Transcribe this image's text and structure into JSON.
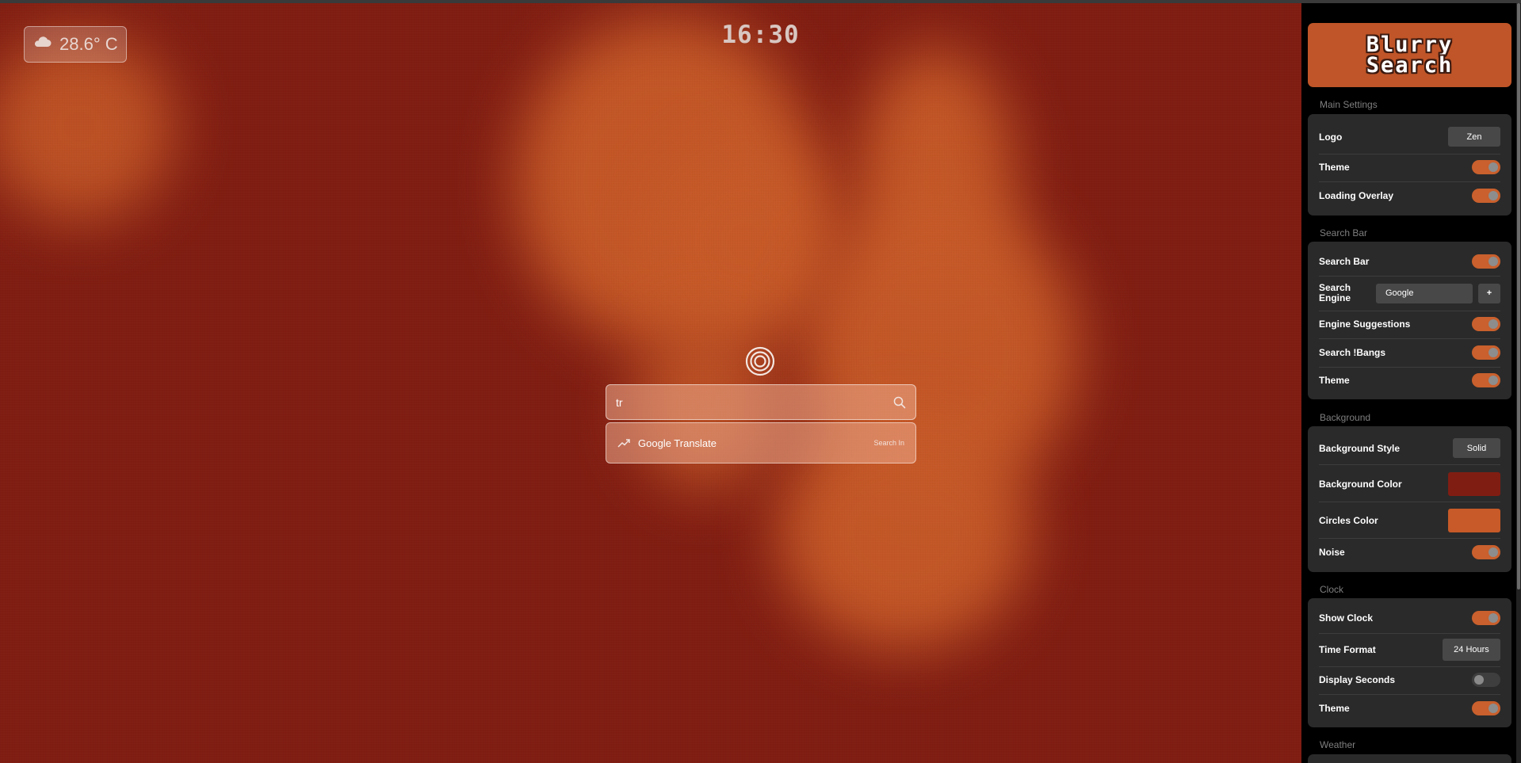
{
  "weather": {
    "icon": "cloud-icon",
    "temperature": "28.6° C"
  },
  "clock": {
    "time": "16:30"
  },
  "search": {
    "query": "tr",
    "search_icon": "magnifier-icon",
    "suggestions": [
      {
        "icon": "trending-icon",
        "text": "Google Translate",
        "hint": "Search In"
      }
    ]
  },
  "panel": {
    "brand": {
      "line1": "Blurry",
      "line2": "Search"
    },
    "main_settings": {
      "title": "Main Settings",
      "logo_label": "Logo",
      "logo_value": "Zen",
      "theme_label": "Theme",
      "theme_on": true,
      "loading_label": "Loading Overlay",
      "loading_on": true
    },
    "search_bar": {
      "title": "Search Bar",
      "bar_label": "Search Bar",
      "bar_on": true,
      "engine_label_1": "Search",
      "engine_label_2": "Engine",
      "engine_value": "Google",
      "add_label": "+",
      "suggest_label": "Engine Suggestions",
      "suggest_on": true,
      "bangs_label": "Search !Bangs",
      "bangs_on": true,
      "theme_label": "Theme",
      "theme_on": true
    },
    "background": {
      "title": "Background",
      "style_label": "Background Style",
      "style_value": "Solid",
      "color_label": "Background Color",
      "color_value": "#801d12",
      "circles_label": "Circles Color",
      "circles_value": "#c75a28",
      "noise_label": "Noise",
      "noise_on": true
    },
    "clock": {
      "title": "Clock",
      "show_label": "Show Clock",
      "show_on": true,
      "format_label": "Time Format",
      "format_value": "24 Hours",
      "seconds_label": "Display Seconds",
      "seconds_on": false,
      "theme_label": "Theme",
      "theme_on": true
    },
    "weather": {
      "title": "Weather"
    }
  },
  "colors": {
    "accent": "#c9602d",
    "panel_card": "#2a2a2a",
    "background": "#801d12"
  }
}
